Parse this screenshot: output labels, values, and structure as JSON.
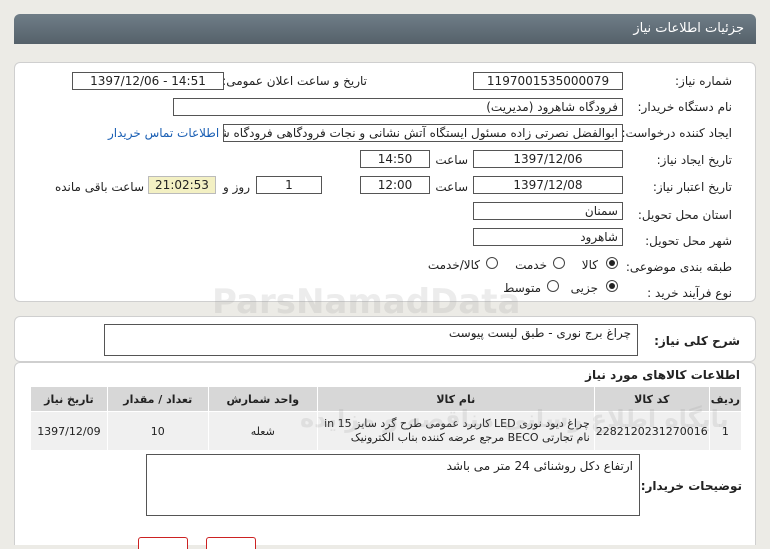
{
  "header": {
    "title": "جزئیات اطلاعات نیاز"
  },
  "form": {
    "need_number_label": "شماره نیاز:",
    "need_number": "1197001535000079",
    "announce_label": "تاریخ و ساعت اعلان عمومی:",
    "announce_value": "1397/12/06 - 14:51",
    "buyer_label": "نام دستگاه خریدار:",
    "buyer_value": "فرودگاه شاهرود (مدیریت)",
    "creator_label": "ایجاد کننده درخواست:",
    "creator_value": "ابوالفضل نصرتی زاده مسئول ایستگاه آتش نشانی و نجات فرودگاهی فرودگاه شاهرود",
    "contact_link": "اطلاعات تماس خریدار",
    "created_date_label": "تاریخ ایجاد نیاز:",
    "created_date": "1397/12/06",
    "time_label": "ساعت",
    "created_time": "14:50",
    "validity_label": "تاریخ اعتبار نیاز:",
    "validity_date": "1397/12/08",
    "validity_time": "12:00",
    "days_value": "1",
    "days_label": "روز و",
    "remaining_time": "21:02:53",
    "remaining_label": "ساعت باقی مانده",
    "province_label": "استان محل تحویل:",
    "province_value": "سمنان",
    "city_label": "شهر محل تحویل:",
    "city_value": "شاهرود",
    "category_label": "طبقه بندی موضوعی:",
    "category_options": [
      "کالا",
      "خدمت",
      "کالا/خدمت"
    ],
    "category_selected": "کالا",
    "process_label": "نوع فرآیند خرید :",
    "process_options": [
      "جزیی",
      "متوسط"
    ],
    "process_selected": "جزیی"
  },
  "summary": {
    "label": "شرح کلی نیاز:",
    "value": "چراغ برج نوری - طبق لیست پیوست"
  },
  "items_section": {
    "title": "اطلاعات کالاهای مورد نیاز",
    "columns": [
      "ردیف",
      "کد کالا",
      "نام کالا",
      "واحد شمارش",
      "تعداد / مقدار",
      "تاریخ نیاز"
    ],
    "rows": [
      {
        "index": "1",
        "code": "2282120231270016",
        "name": "چراغ دیود نوری LED کاربرد عمومی طرح گرد سایز 15 in نام تجارتی BECO مرجع عرضه کننده بناب الکترونیک",
        "unit": "شعله",
        "qty": "10",
        "date": "1397/12/09"
      }
    ]
  },
  "buyer_notes": {
    "label": "توضیحات خریدار:",
    "value": "ارتفاع دکل روشنائی 24 متر می باشد"
  },
  "watermark": {
    "line1": "ParsNamadData",
    "line2": "پایگاه اطلاع رسانی مناقصه و مزایده"
  }
}
